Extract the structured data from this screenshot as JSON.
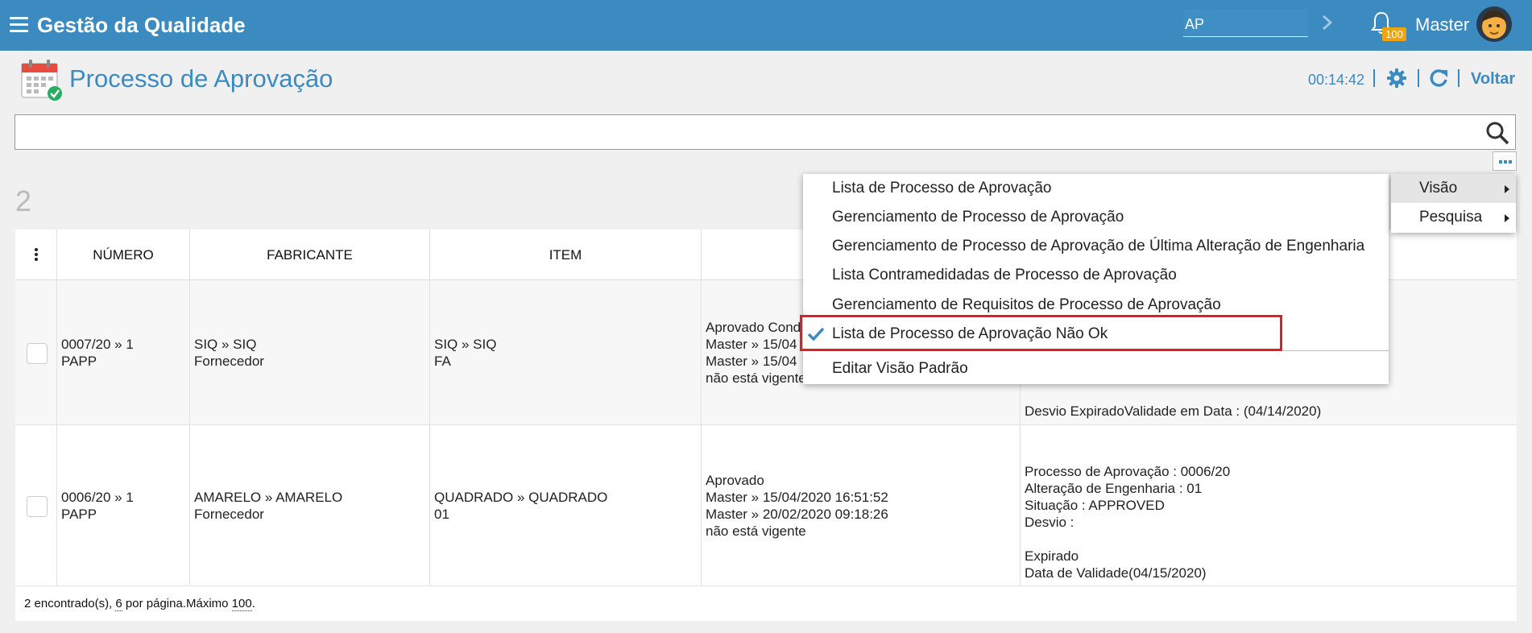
{
  "topbar": {
    "app_title": "Gestão da Qualidade",
    "search_value": "AP",
    "notification_count": "100",
    "user_name": "Master",
    "bg_color": "#3b8bc0",
    "badge_color": "#f0a30a"
  },
  "header": {
    "title": "Processo de Aprovação",
    "timer": "00:14:42",
    "back_label": "Voltar"
  },
  "search": {
    "value": "",
    "placeholder": ""
  },
  "result_count": "2",
  "table": {
    "columns": [
      "NÚMERO",
      "FABRICANTE",
      "ITEM"
    ],
    "rows": [
      {
        "numero": [
          "0007/20 » 1",
          "PAPP"
        ],
        "fabricante": [
          "SIQ » SIQ",
          "Fornecedor"
        ],
        "item": [
          "SIQ » SIQ",
          "FA"
        ],
        "status": [
          "Aprovado Cond",
          "Master » 15/04",
          "Master » 15/04",
          "não está vigente"
        ],
        "details": [
          "Desvio ExpiradoValidade em Data : (04/14/2020)"
        ]
      },
      {
        "numero": [
          "0006/20 » 1",
          "PAPP"
        ],
        "fabricante": [
          "AMARELO » AMARELO",
          "Fornecedor"
        ],
        "item": [
          "QUADRADO » QUADRADO",
          "01"
        ],
        "status": [
          "Aprovado",
          "Master » 15/04/2020 16:51:52",
          "Master » 20/02/2020 09:18:26",
          "não está vigente"
        ],
        "details": [
          "Processo de Aprovação : 0006/20",
          "Alteração de Engenharia : 01",
          "Situação : APPROVED",
          "Desvio :",
          "",
          "Expirado",
          "Data de Validade(04/15/2020)"
        ]
      }
    ],
    "footer": {
      "found": "2 encontrado(s), ",
      "per_page_value": "6",
      "per_page_text": " por página.",
      "max_label": "Máximo ",
      "max_value": "100",
      "end": "."
    }
  },
  "menu": {
    "root_items": [
      {
        "label": "Visão",
        "active": true
      },
      {
        "label": "Pesquisa",
        "active": false
      }
    ],
    "view_items": [
      {
        "label": "Lista de Processo de Aprovação",
        "checked": false
      },
      {
        "label": "Gerenciamento de Processo de Aprovação",
        "checked": false
      },
      {
        "label": "Gerenciamento de Processo de Aprovação de Última Alteração de Engenharia",
        "checked": false
      },
      {
        "label": "Lista Contramedidadas de Processo de Aprovação",
        "checked": false
      },
      {
        "label": "Gerenciamento de Requisitos de Processo de Aprovação",
        "checked": false
      },
      {
        "label": "Lista de Processo de Aprovação Não Ok",
        "checked": true
      }
    ],
    "edit_default_label": "Editar Visão Padrão",
    "highlight_color": "#e02020"
  }
}
